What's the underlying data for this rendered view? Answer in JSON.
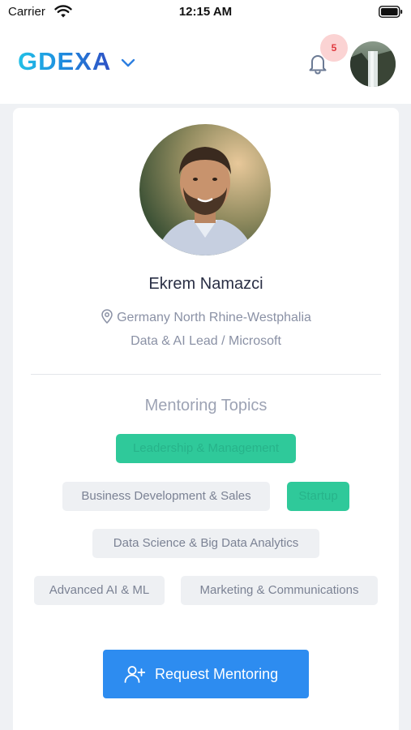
{
  "status_bar": {
    "carrier": "Carrier",
    "time": "12:15 AM"
  },
  "header": {
    "logo": "GDEXA",
    "notification_count": "5"
  },
  "profile": {
    "name": "Ekrem Namazci",
    "location": "Germany North Rhine-Westphalia",
    "role": "Data & AI Lead / Microsoft"
  },
  "topics": {
    "title": "Mentoring Topics",
    "items": [
      {
        "label": "Leadership & Management",
        "selected": true
      },
      {
        "label": "Business Development & Sales",
        "selected": false
      },
      {
        "label": "Startup",
        "selected": true
      },
      {
        "label": "Data Science & Big Data Analytics",
        "selected": false
      },
      {
        "label": "Advanced AI & ML",
        "selected": false
      },
      {
        "label": "Marketing & Communications",
        "selected": false
      }
    ]
  },
  "actions": {
    "request_label": "Request Mentoring"
  },
  "colors": {
    "accent": "#2d8cf0",
    "selected_tag": "#2fc99a",
    "badge_bg": "#fbd3d3",
    "badge_text": "#e0393e"
  }
}
